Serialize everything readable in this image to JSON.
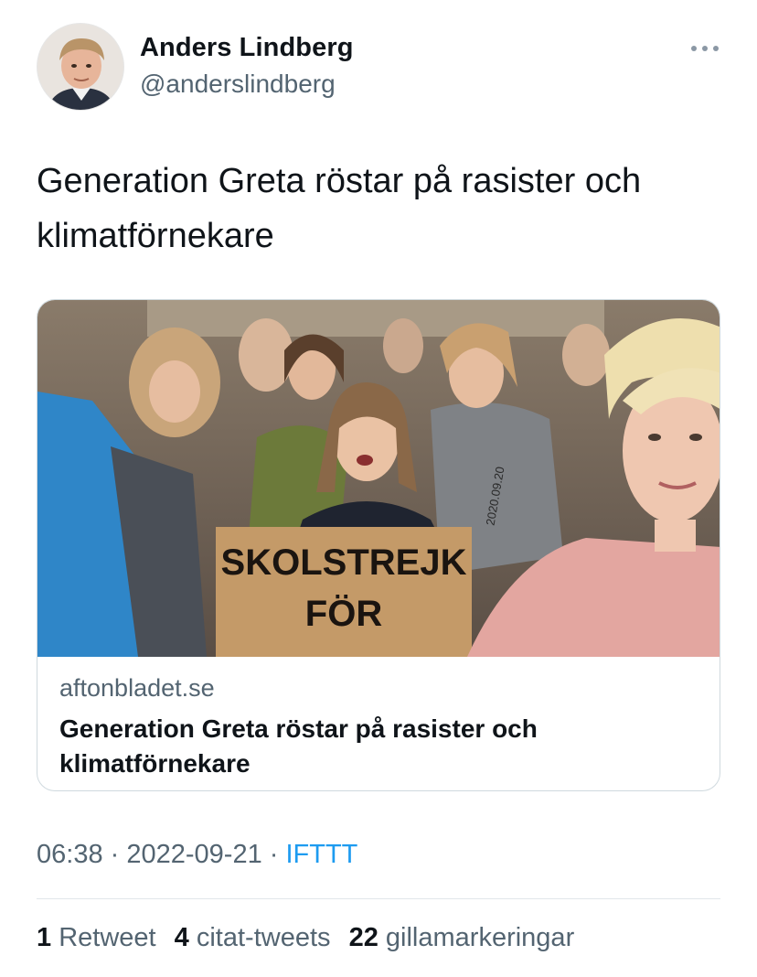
{
  "author": {
    "display_name": "Anders Lindberg",
    "handle": "@anderslindberg"
  },
  "tweet": {
    "text": "Generation Greta röstar på rasister och klimatförnekare"
  },
  "card": {
    "sign_text_line1": "SKOLSTREJK",
    "sign_text_line2": "FÖR",
    "shirt_text": "2020.09.20",
    "domain": "aftonbladet.se",
    "title": "Generation Greta röstar på rasister och klimatförnekare"
  },
  "meta": {
    "time": "06:38",
    "separator1": " · ",
    "date": "2022-09-21",
    "separator2": " · ",
    "source": "IFTTT"
  },
  "stats": {
    "retweets_count": "1",
    "retweets_label": "Retweet",
    "quotes_count": "4",
    "quotes_label": "citat-tweets",
    "likes_count": "22",
    "likes_label": "gillamarkeringar"
  },
  "colors": {
    "text_primary": "#0f1419",
    "text_secondary": "#536471",
    "link": "#1d9bf0",
    "border": "#cfd9de"
  }
}
